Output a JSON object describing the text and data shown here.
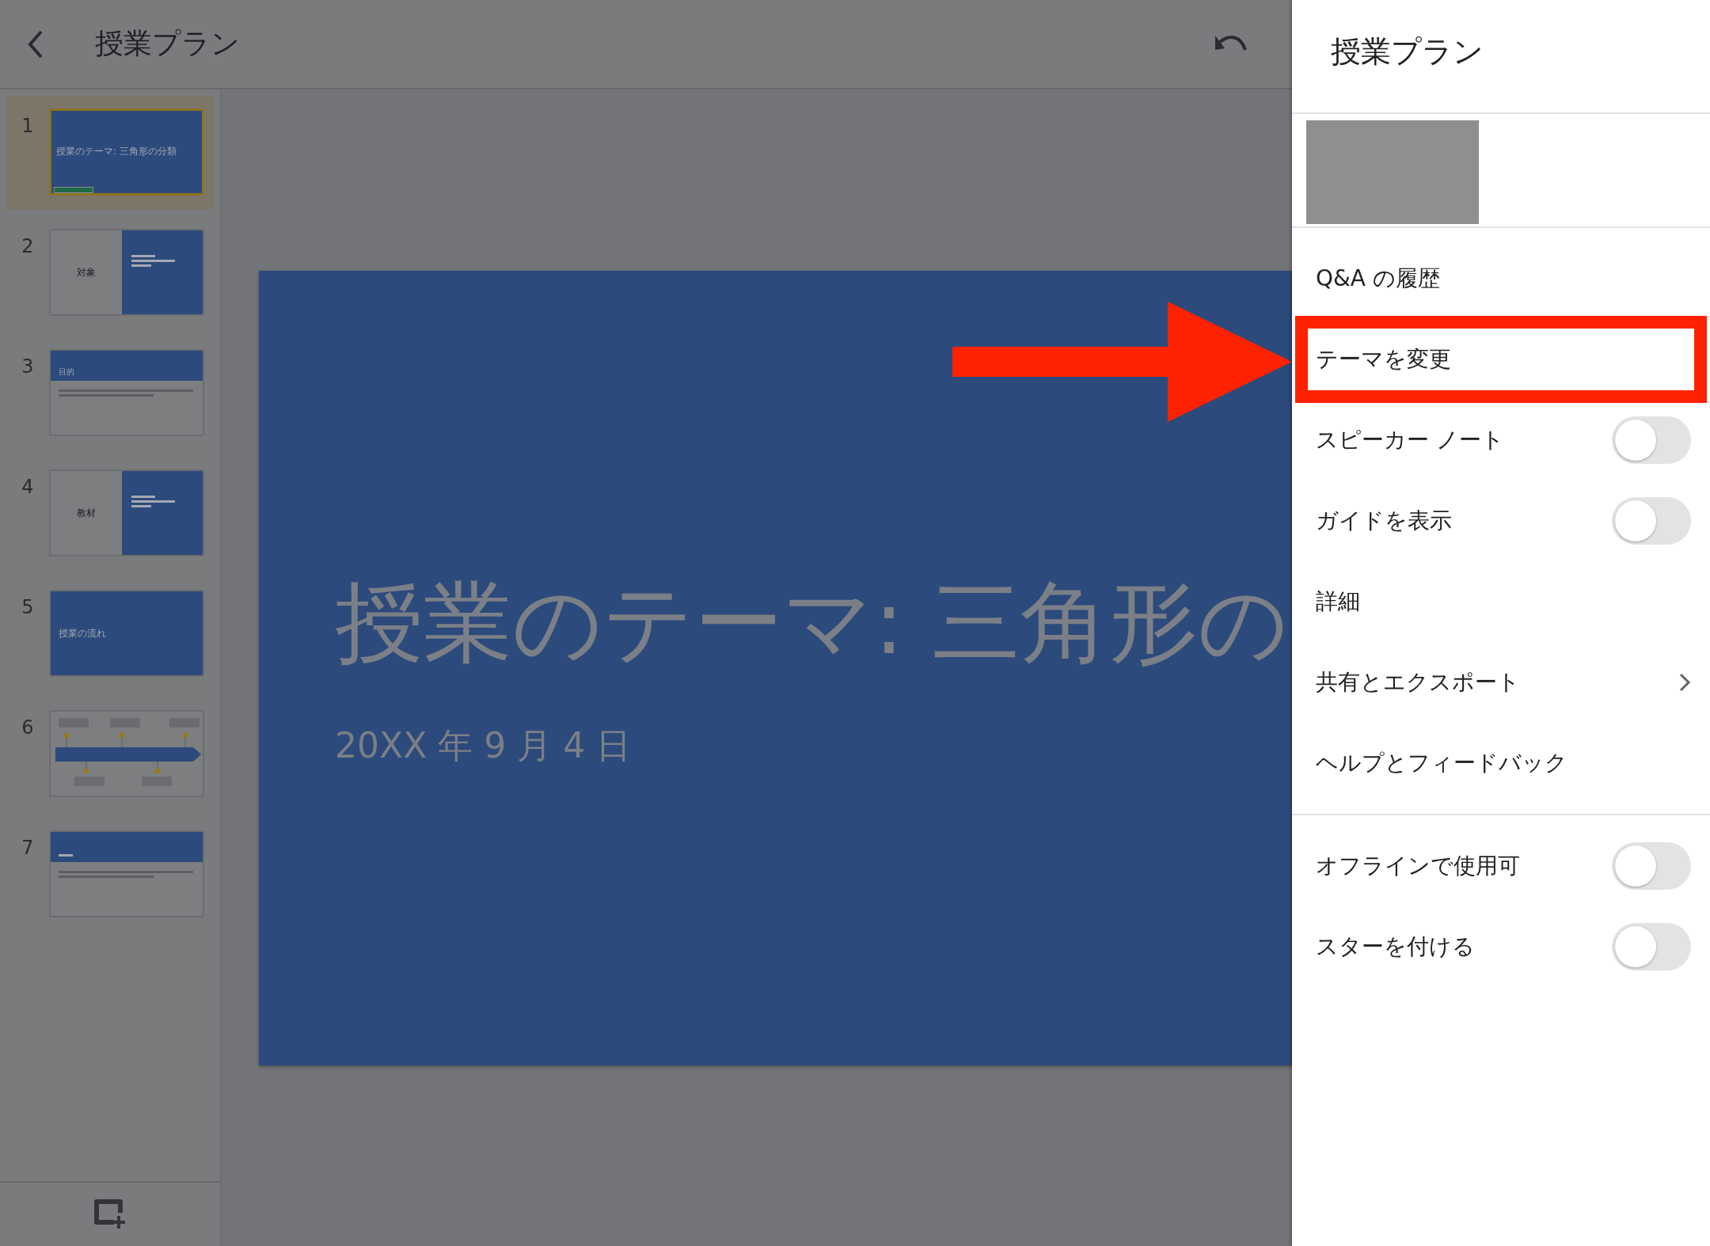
{
  "top_bar": {
    "title": "授業プラン"
  },
  "slides": [
    {
      "number": "1",
      "kind": "title",
      "title": "授業のテーマ: 三角形の分類",
      "selected": true
    },
    {
      "number": "2",
      "kind": "split",
      "title": "対象",
      "selected": false
    },
    {
      "number": "3",
      "kind": "header",
      "title": "目的",
      "selected": false
    },
    {
      "number": "4",
      "kind": "split",
      "title": "教材",
      "selected": false
    },
    {
      "number": "5",
      "kind": "section",
      "title": "授業の流れ",
      "selected": false
    },
    {
      "number": "6",
      "kind": "timeline",
      "selected": false
    },
    {
      "number": "7",
      "kind": "header",
      "selected": false
    }
  ],
  "current_slide": {
    "title": "授業のテーマ: 三角形の",
    "subtitle": "20XX 年 9 月 4 日"
  },
  "panel": {
    "title": "授業プラン",
    "groups": [
      [
        {
          "label": "Q&A の履歴",
          "kind": "plain",
          "highlighted": false
        },
        {
          "label": "テーマを変更",
          "kind": "plain",
          "highlighted": true
        },
        {
          "label": "スピーカー ノート",
          "kind": "toggle",
          "on": false,
          "highlighted": false
        },
        {
          "label": "ガイドを表示",
          "kind": "toggle",
          "on": false,
          "highlighted": false
        },
        {
          "label": "詳細",
          "kind": "plain",
          "highlighted": false
        },
        {
          "label": "共有とエクスポート",
          "kind": "submenu",
          "highlighted": false
        },
        {
          "label": "ヘルプとフィードバック",
          "kind": "plain",
          "highlighted": false
        }
      ],
      [
        {
          "label": "オフラインで使用可",
          "kind": "toggle",
          "on": false,
          "highlighted": false
        },
        {
          "label": "スターを付ける",
          "kind": "toggle",
          "on": false,
          "highlighted": false
        }
      ]
    ]
  }
}
